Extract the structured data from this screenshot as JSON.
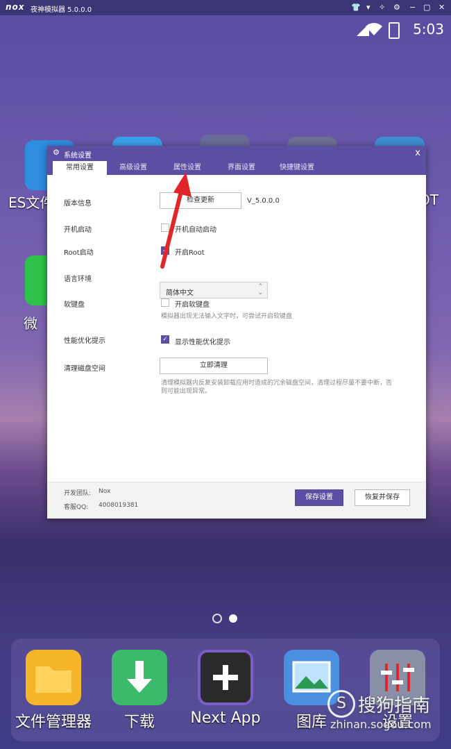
{
  "titlebar": {
    "logo": "nox",
    "title": "夜神模拟器 5.0.0.0",
    "controls": [
      "shirt-icon",
      "menu-icon",
      "pin-icon",
      "gear-icon",
      "minimize-icon",
      "restore-icon",
      "close-icon"
    ],
    "control_glyphs": [
      "👕",
      "▾",
      "✧",
      "⚙",
      "−",
      "▢",
      "✕"
    ]
  },
  "status_bar": {
    "time": "5:03"
  },
  "desktop": {
    "labels": {
      "es": "ES文件",
      "wechat": "微",
      "right": "OT"
    },
    "page_dots": {
      "active_index": 1
    }
  },
  "dock": {
    "items": [
      {
        "label": "文件管理器",
        "icon": "folder-icon",
        "color": "#f5b52a"
      },
      {
        "label": "下载",
        "icon": "download-icon",
        "color": "#3cb96b"
      },
      {
        "label": "Next App",
        "icon": "plus-icon",
        "color": "#2a2a2a"
      },
      {
        "label": "图库",
        "icon": "gallery-icon",
        "color": "#4a8fe0"
      },
      {
        "label": "设置",
        "icon": "sliders-icon",
        "color": "#8a8fa8"
      }
    ]
  },
  "dialog": {
    "title": "系统设置",
    "close": "x",
    "tabs": [
      {
        "label": "常用设置",
        "active": true
      },
      {
        "label": "高级设置",
        "active": false
      },
      {
        "label": "属性设置",
        "active": false
      },
      {
        "label": "界面设置",
        "active": false
      },
      {
        "label": "快捷键设置",
        "active": false
      }
    ],
    "version_label": "版本信息",
    "check_update_button": "检查更新",
    "version_value": "V_5.0.0.0",
    "boot_label": "开机启动",
    "boot_checkbox": "开机自动启动",
    "boot_checked": false,
    "root_label": "Root启动",
    "root_checkbox": "开启Root",
    "root_checked": true,
    "language_label": "语言环境",
    "language_value": "简体中文",
    "keyboard_label": "软键盘",
    "keyboard_checkbox": "开启软键盘",
    "keyboard_checked": false,
    "keyboard_hint": "模拟器出现无法输入文字时，可尝试开启软键盘",
    "perf_label": "性能优化提示",
    "perf_checkbox": "显示性能优化提示",
    "perf_checked": true,
    "disk_label": "清理磁盘空间",
    "clean_button": "立即清理",
    "disk_hint_1": "清理模拟器内反复安装卸载应用时造成的冗余磁盘空间，清理过程尽量不要中断，否",
    "disk_hint_2": "则可能出现异常。",
    "footer": {
      "team_label": "开发团队:",
      "team_value": "Nox",
      "qq_label": "客服QQ:",
      "qq_value": "4008019381",
      "save_button": "保存设置",
      "restore_button": "恢复并保存"
    }
  },
  "watermark": {
    "logo": "S",
    "text": "搜狗指南",
    "url": "zhinan.sogou.com"
  },
  "colors": {
    "accent": "#5b4fa4",
    "arrow": "#e0262b"
  }
}
